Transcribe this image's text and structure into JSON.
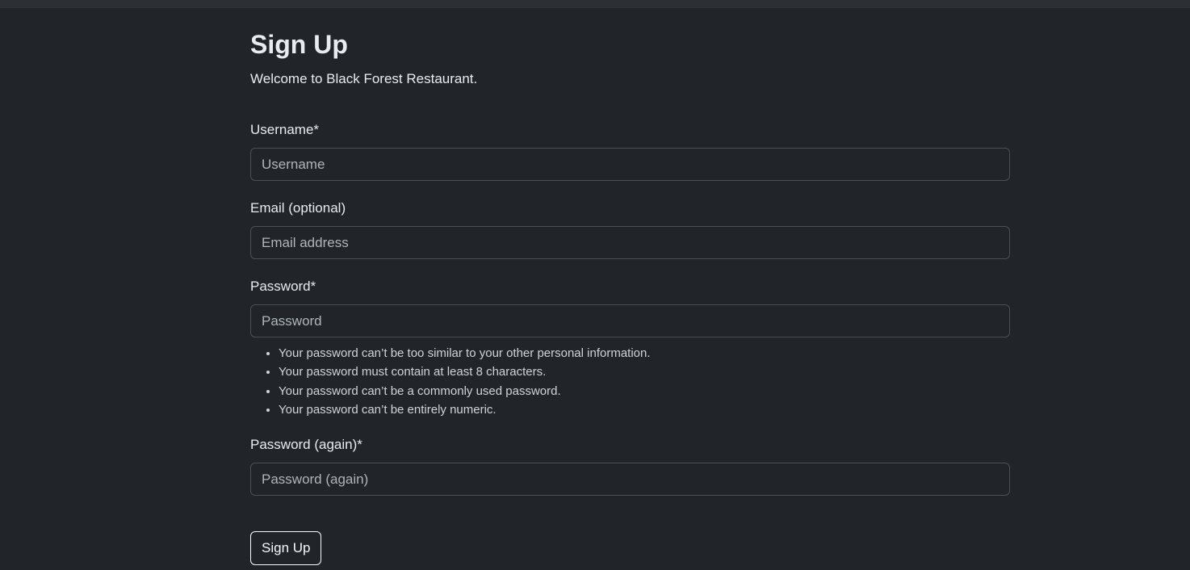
{
  "header": {
    "title": "Sign Up",
    "welcome": "Welcome to Black Forest Restaurant."
  },
  "form": {
    "username": {
      "label": "Username*",
      "placeholder": "Username",
      "value": ""
    },
    "email": {
      "label": "Email (optional)",
      "placeholder": "Email address",
      "value": ""
    },
    "password": {
      "label": "Password*",
      "placeholder": "Password",
      "value": "",
      "help": [
        "Your password can’t be too similar to your other personal information.",
        "Your password must contain at least 8 characters.",
        "Your password can’t be a commonly used password.",
        "Your password can’t be entirely numeric."
      ]
    },
    "password_again": {
      "label": "Password (again)*",
      "placeholder": "Password (again)",
      "value": ""
    },
    "submit_label": "Sign Up"
  },
  "colors": {
    "background": "#212529",
    "top_strip": "#2b3035",
    "input_border": "#495057",
    "text": "#dee2e6",
    "placeholder": "#adb5bd",
    "button_border": "#f8f9fa"
  }
}
